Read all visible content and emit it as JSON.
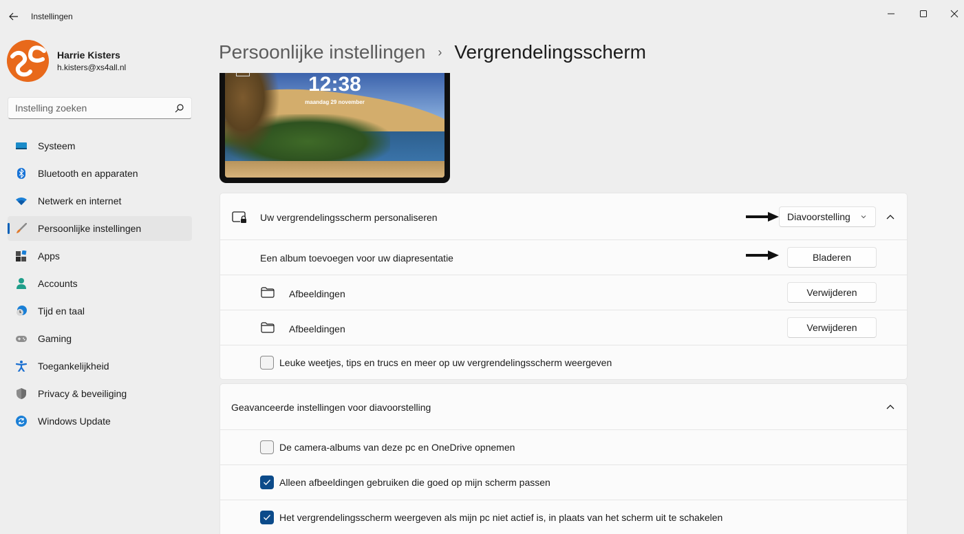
{
  "window": {
    "title": "Instellingen",
    "controls": [
      "minimize",
      "maximize",
      "close"
    ]
  },
  "profile": {
    "name": "Harrie Kisters",
    "email": "h.kisters@xs4all.nl"
  },
  "search": {
    "placeholder": "Instelling zoeken",
    "value": ""
  },
  "sidebar": {
    "items": [
      {
        "label": "Systeem",
        "icon": "monitor-icon",
        "active": false
      },
      {
        "label": "Bluetooth en apparaten",
        "icon": "bluetooth-icon",
        "active": false
      },
      {
        "label": "Netwerk en internet",
        "icon": "wifi-icon",
        "active": false
      },
      {
        "label": "Persoonlijke instellingen",
        "icon": "paintbrush-icon",
        "active": true
      },
      {
        "label": "Apps",
        "icon": "apps-icon",
        "active": false
      },
      {
        "label": "Accounts",
        "icon": "person-icon",
        "active": false
      },
      {
        "label": "Tijd en taal",
        "icon": "clock-globe-icon",
        "active": false
      },
      {
        "label": "Gaming",
        "icon": "gamepad-icon",
        "active": false
      },
      {
        "label": "Toegankelijkheid",
        "icon": "accessibility-icon",
        "active": false
      },
      {
        "label": "Privacy & beveiliging",
        "icon": "shield-icon",
        "active": false
      },
      {
        "label": "Windows Update",
        "icon": "update-icon",
        "active": false
      }
    ]
  },
  "breadcrumb": {
    "parent": "Persoonlijke instellingen",
    "separator": "›",
    "current": "Vergrendelingsscherm"
  },
  "preview": {
    "time": "12:38",
    "date": "maandag 29 november"
  },
  "personalize_section": {
    "title": "Uw vergrendelingsscherm personaliseren",
    "dropdown_value": "Diavoorstelling",
    "expanded": true,
    "add_album_label": "Een album toevoegen voor uw diapresentatie",
    "browse_button": "Bladeren",
    "albums": [
      {
        "name": "Afbeeldingen",
        "remove_button": "Verwijderen"
      },
      {
        "name": "Afbeeldingen",
        "remove_button": "Verwijderen"
      }
    ],
    "tips_checkbox": {
      "label": "Leuke weetjes, tips en trucs en meer op uw vergrendelingsscherm weergeven",
      "checked": false
    }
  },
  "advanced_section": {
    "title": "Geavanceerde instellingen voor diavoorstelling",
    "expanded": true,
    "options": [
      {
        "label": "De camera-albums van deze pc en OneDrive opnemen",
        "checked": false
      },
      {
        "label": "Alleen afbeeldingen gebruiken die goed op mijn scherm passen",
        "checked": true
      },
      {
        "label": "Het vergrendelingsscherm weergeven als mijn pc niet actief is, in plaats van het scherm uit te schakelen",
        "checked": true
      }
    ]
  },
  "colors": {
    "accent": "#005fb8",
    "checkbox_checked": "#0c4b8a",
    "avatar": "#e8691b"
  }
}
